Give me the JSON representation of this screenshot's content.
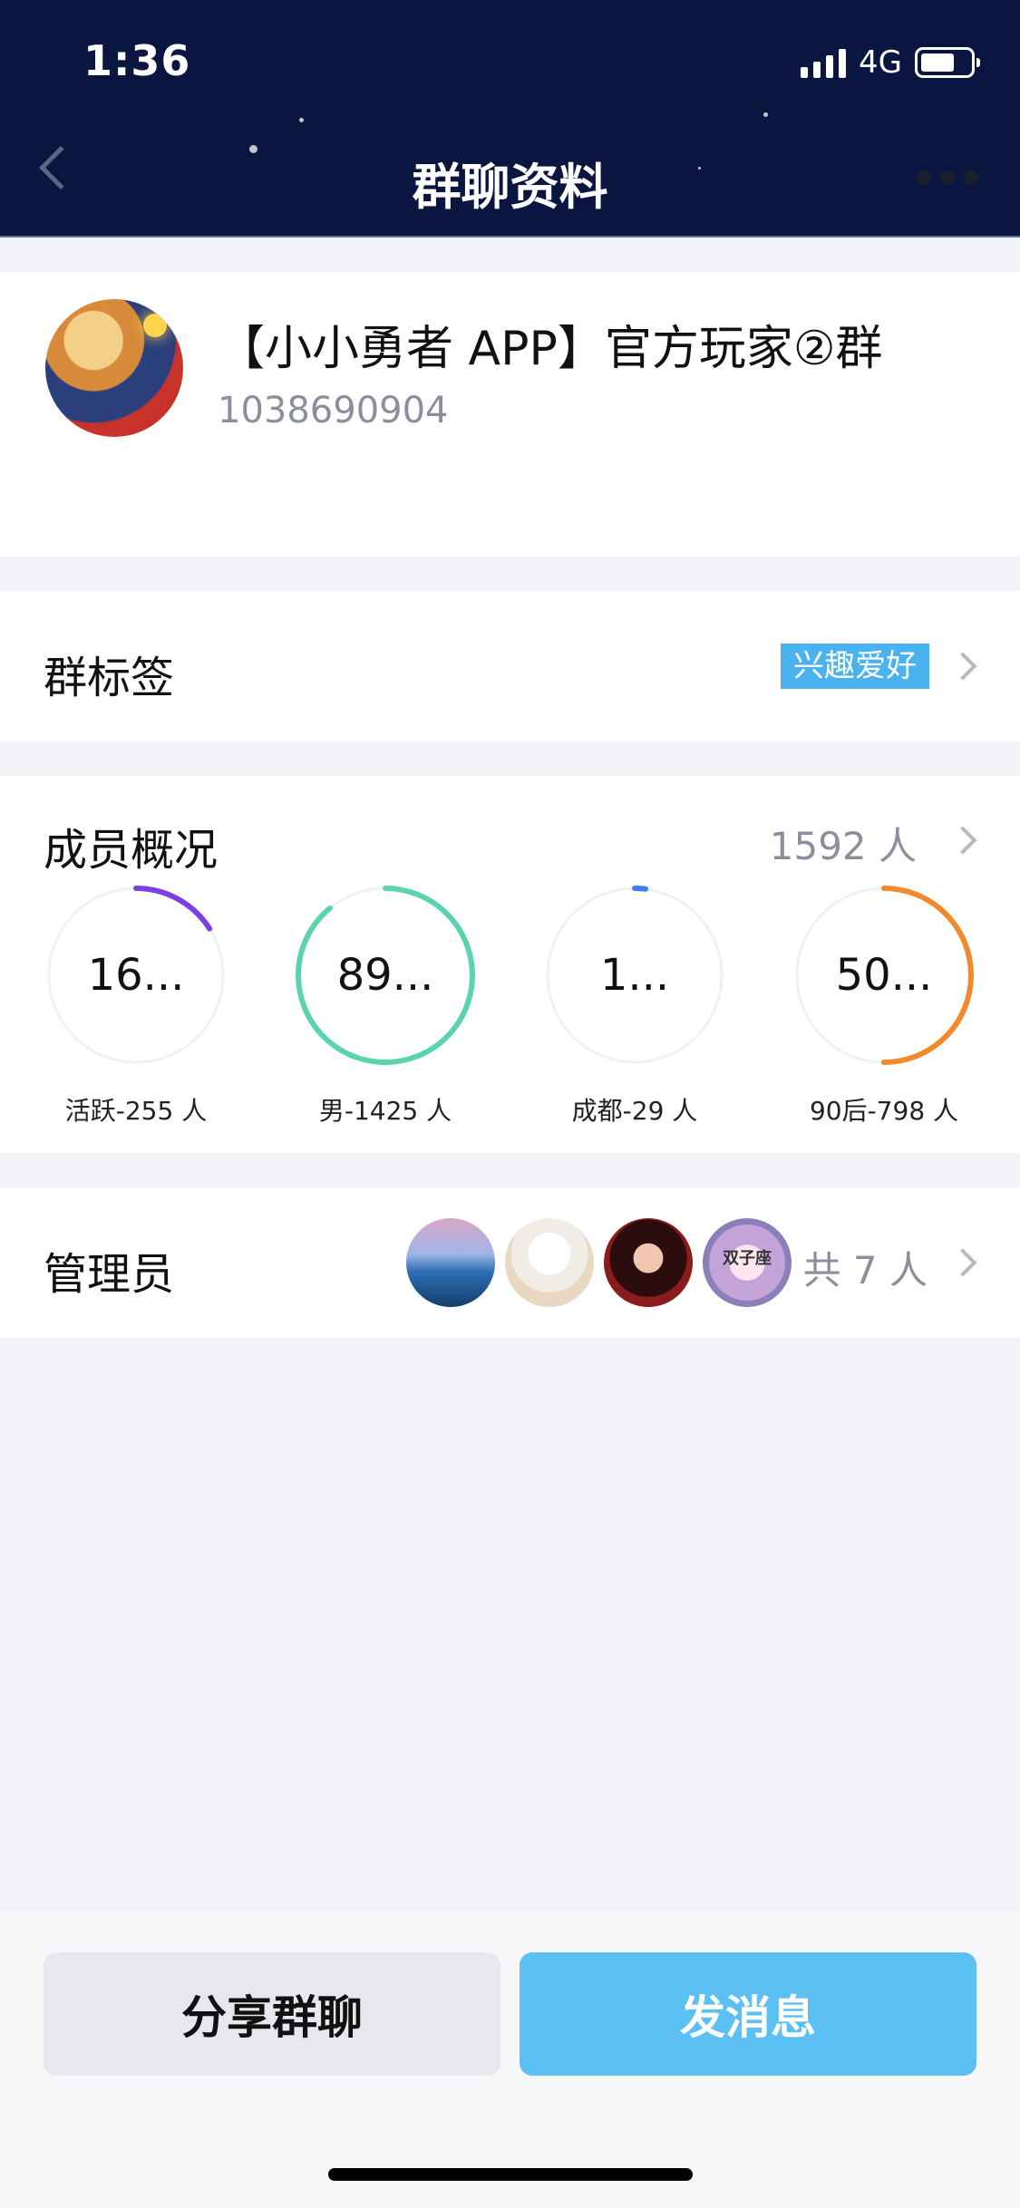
{
  "status_bar": {
    "time": "1:36",
    "network": "4G",
    "battery_level": 0.7
  },
  "header": {
    "title": "群聊资料"
  },
  "group": {
    "name": "【小小勇者 APP】官方玩家②群",
    "id": "1038690904"
  },
  "tag_row": {
    "label": "群标签",
    "tag": "兴趣爱好"
  },
  "members": {
    "label": "成员概况",
    "count": "1592 人",
    "stats": [
      {
        "value": "16...",
        "label": "活跃-255 人",
        "color": "#7b3fe4",
        "fraction": 0.16
      },
      {
        "value": "89...",
        "label": "男-1425 人",
        "color": "#5bd3b0",
        "fraction": 0.89
      },
      {
        "value": "1...",
        "label": "成都-29 人",
        "color": "#3a7ff0",
        "fraction": 0.02
      },
      {
        "value": "50...",
        "label": "90后-798 人",
        "color": "#f08a2a",
        "fraction": 0.5
      }
    ]
  },
  "admins": {
    "label": "管理员",
    "count": "共 7 人",
    "avatar4_text": "双子座"
  },
  "buttons": {
    "share": "分享群聊",
    "send": "发消息"
  }
}
